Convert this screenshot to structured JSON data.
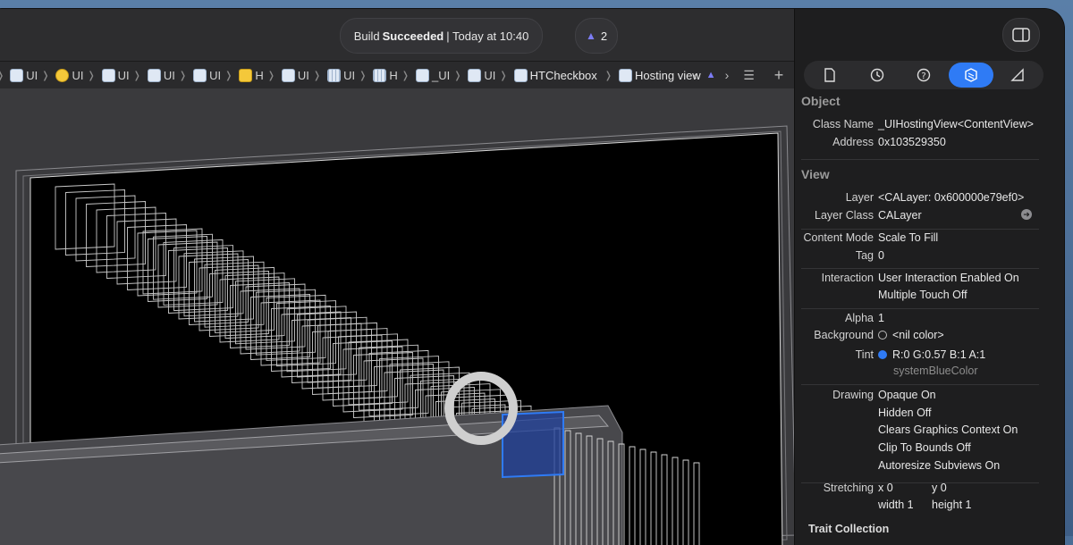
{
  "toolbar": {
    "status_prefix": "Build",
    "status_strong": "Succeeded",
    "status_suffix": "| Today at 10:40",
    "warning_count": "2"
  },
  "jumpbar": {
    "items": [
      {
        "label": "UI",
        "icon": "view-icon"
      },
      {
        "label": "UI",
        "icon": "view-controller-icon"
      },
      {
        "label": "UI",
        "icon": "view-icon"
      },
      {
        "label": "UI",
        "icon": "view-icon"
      },
      {
        "label": "UI",
        "icon": "view-icon"
      },
      {
        "label": "H",
        "icon": "hosting-controller-icon"
      },
      {
        "label": "UI",
        "icon": "view-icon"
      },
      {
        "label": "UI",
        "icon": "grid-view-icon"
      },
      {
        "label": "H",
        "icon": "grid-view-icon"
      },
      {
        "label": "_UI",
        "icon": "view-icon"
      },
      {
        "label": "UI",
        "icon": "view-icon"
      },
      {
        "label": "HTCheckbox",
        "icon": "view-icon"
      },
      {
        "label": "Hosting view",
        "icon": "hosting-view-icon"
      }
    ]
  },
  "inspector": {
    "tabs": [
      "file-inspector-icon",
      "history-icon",
      "help-icon",
      "object-inspector-icon",
      "size-inspector-icon"
    ],
    "active_tab": 3,
    "object": {
      "title": "Object",
      "class_name_label": "Class Name",
      "class_name": "_UIHostingView<ContentView>",
      "address_label": "Address",
      "address": "0x103529350"
    },
    "view": {
      "title": "View",
      "layer_label": "Layer",
      "layer": "<CALayer: 0x600000e79ef0>",
      "layer_class_label": "Layer Class",
      "layer_class": "CALayer",
      "content_mode_label": "Content Mode",
      "content_mode": "Scale To Fill",
      "tag_label": "Tag",
      "tag": "0",
      "interaction_label": "Interaction",
      "interaction_1": "User Interaction Enabled On",
      "interaction_2": "Multiple Touch Off",
      "alpha_label": "Alpha",
      "alpha": "1",
      "background_label": "Background",
      "background": "<nil color>",
      "tint_label": "Tint",
      "tint": "R:0 G:0.57 B:1 A:1",
      "tint_name": "systemBlueColor",
      "tint_color": "#2f7bf5",
      "drawing_label": "Drawing",
      "drawing": [
        "Opaque On",
        "Hidden Off",
        "Clears Graphics Context On",
        "Clip To Bounds Off",
        "Autoresize Subviews On"
      ],
      "stretching_label": "Stretching",
      "stretch_x_label": "x",
      "stretch_x": "0",
      "stretch_y_label": "y",
      "stretch_y": "0",
      "stretch_w_label": "width",
      "stretch_w": "1",
      "stretch_h_label": "height",
      "stretch_h": "1"
    },
    "trait_title": "Trait Collection"
  }
}
